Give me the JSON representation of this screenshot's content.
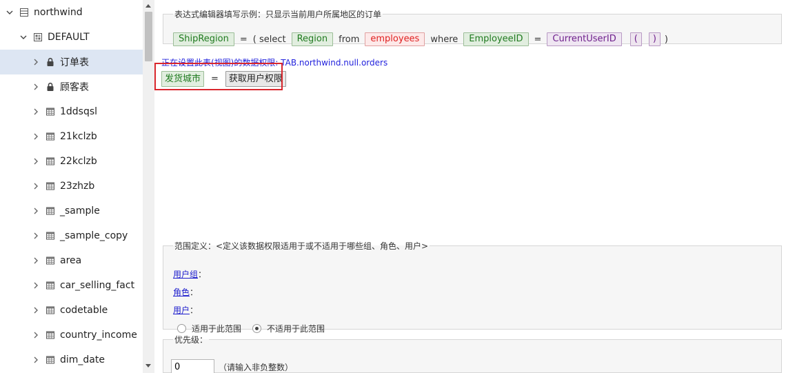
{
  "tree": {
    "root": {
      "label": "northwind",
      "icon": "database-icon"
    },
    "schema": {
      "label": "DEFAULT",
      "icon": "schema-icon"
    },
    "items": [
      {
        "label": "订单表",
        "icon": "lock-icon",
        "selected": true
      },
      {
        "label": "顾客表",
        "icon": "lock-icon",
        "selected": false
      },
      {
        "label": "1ddsqsl",
        "icon": "table-icon",
        "selected": false
      },
      {
        "label": "21kclzb",
        "icon": "table-icon",
        "selected": false
      },
      {
        "label": "22kclzb",
        "icon": "table-icon",
        "selected": false
      },
      {
        "label": "23zhzb",
        "icon": "table-icon",
        "selected": false
      },
      {
        "label": "_sample",
        "icon": "table-icon",
        "selected": false
      },
      {
        "label": "_sample_copy",
        "icon": "table-icon",
        "selected": false
      },
      {
        "label": "area",
        "icon": "table-icon",
        "selected": false
      },
      {
        "label": "car_selling_fact",
        "icon": "table-icon",
        "selected": false
      },
      {
        "label": "codetable",
        "icon": "table-icon",
        "selected": false
      },
      {
        "label": "country_income",
        "icon": "table-icon",
        "selected": false
      },
      {
        "label": "dim_date",
        "icon": "table-icon",
        "selected": false
      }
    ]
  },
  "example": {
    "legend": "表达式编辑器填写示例：只显示当前用户所属地区的订单",
    "field1": "ShipRegion",
    "eq1": "=",
    "open_select": "( select",
    "field2": "Region",
    "from": "from",
    "table": "employees",
    "where": "where",
    "field3": "EmployeeID",
    "eq2": "=",
    "func": "CurrentUserID",
    "lparen": "(",
    "rparen": ")",
    "close": ")"
  },
  "editing_label": "正在设置此表(视图)的数据权限: TAB.northwind.null.orders",
  "editor": {
    "field": "发货城市",
    "eq": "=",
    "function": "获取用户权限"
  },
  "scope": {
    "legend": "范围定义：<定义该数据权限适用于或不适用于哪些组、角色、用户>",
    "user_group_link": "用户组",
    "role_link": "角色",
    "user_link": "用户",
    "colon": "：",
    "apply_label": "适用于此范围",
    "not_apply_label": "不适用于此范围",
    "selected": "not_apply"
  },
  "priority": {
    "legend": "优先级：",
    "value": "0",
    "hint": "（请输入非负整数）"
  },
  "colors": {
    "selection_bg": "#dde6f3",
    "highlight_border": "#d9262c",
    "link": "#1a1acc",
    "field_text": "#1f7a1f",
    "table_text": "#e02020",
    "func_text": "#6e1f8c"
  }
}
